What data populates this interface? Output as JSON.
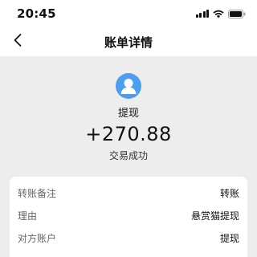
{
  "status_bar": {
    "time": "20:45",
    "icons": [
      "signal-icon",
      "wifi-icon",
      "battery-icon"
    ]
  },
  "nav": {
    "back_icon": "chevron-left-icon",
    "title": "账单详情"
  },
  "summary": {
    "avatar_icon": "user-avatar-icon",
    "avatar_color": "#4a9ff0",
    "merchant": "提现",
    "amount": "+270.88",
    "status": "交易成功"
  },
  "details": [
    {
      "label": "转账备注",
      "value": "转账"
    },
    {
      "label": "理由",
      "value": "悬赏猫提现"
    },
    {
      "label": "对方账户",
      "value": "提现"
    }
  ],
  "colors": {
    "background": "#ededed",
    "card": "#ffffff",
    "accent": "#4a9ff0"
  }
}
